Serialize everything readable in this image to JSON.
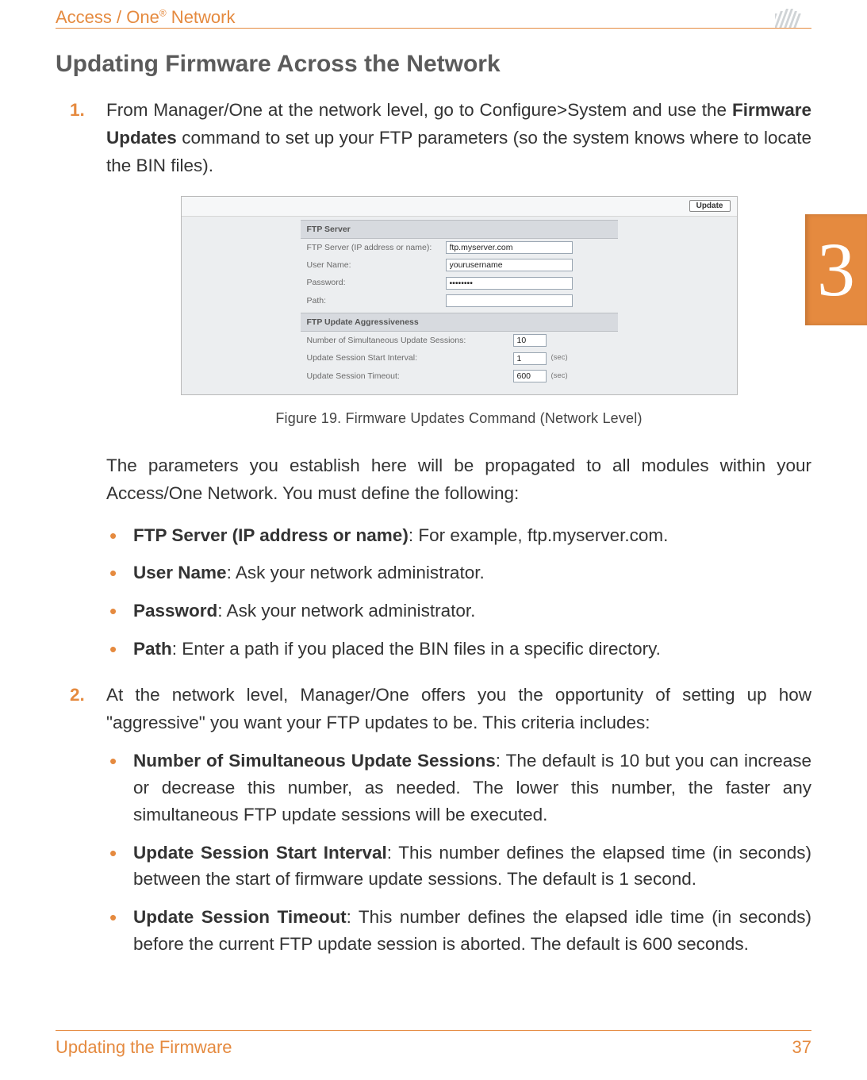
{
  "header": {
    "title_prefix": "Access / One",
    "title_suffix": " Network"
  },
  "chapter": {
    "number": "3"
  },
  "section": {
    "heading": "Updating Firmware Across the Network"
  },
  "steps": [
    {
      "num": "1.",
      "paras": [
        {
          "runs": [
            {
              "t": "From Manager/One at the network level, go to Configure>System and use the "
            },
            {
              "t": "Firmware Updates",
              "b": true
            },
            {
              "t": " command to set up your FTP parameters (so the system knows where to locate the BIN files)."
            }
          ]
        }
      ],
      "figure": {
        "update_btn": "Update",
        "group1": "FTP Server",
        "rows1": [
          {
            "label": "FTP Server (IP address or name):",
            "value": "ftp.myserver.com",
            "type": "text",
            "cls": "w-long"
          },
          {
            "label": "User Name:",
            "value": "yourusername",
            "type": "text",
            "cls": "w-long"
          },
          {
            "label": "Password:",
            "value": "••••••••",
            "type": "password",
            "cls": "w-long"
          },
          {
            "label": "Path:",
            "value": "",
            "type": "text",
            "cls": "w-long-empty"
          }
        ],
        "group2": "FTP Update Aggressiveness",
        "rows2": [
          {
            "label": "Number of Simultaneous Update Sessions:",
            "value": "10",
            "unit": ""
          },
          {
            "label": "Update Session Start Interval:",
            "value": "1",
            "unit": "(sec)"
          },
          {
            "label": "Update Session Timeout:",
            "value": "600",
            "unit": "(sec)"
          }
        ],
        "caption": "Figure 19. Firmware Updates Command (Network Level)"
      },
      "after_figure": "The parameters you establish here will be propagated to all modules within your Access/One Network. You must define the following:",
      "bullets": [
        {
          "runs": [
            {
              "t": "FTP Server (IP address or name)",
              "b": true
            },
            {
              "t": ": For example, ftp.myserver.com."
            }
          ]
        },
        {
          "runs": [
            {
              "t": "User Name",
              "b": true
            },
            {
              "t": ": Ask your network administrator."
            }
          ]
        },
        {
          "runs": [
            {
              "t": "Password",
              "b": true
            },
            {
              "t": ": Ask your network administrator."
            }
          ]
        },
        {
          "runs": [
            {
              "t": "Path",
              "b": true
            },
            {
              "t": ": Enter a path if you placed the BIN files in a specific directory."
            }
          ]
        }
      ]
    },
    {
      "num": "2.",
      "paras": [
        {
          "runs": [
            {
              "t": "At the network level, Manager/One offers you the opportunity of setting up how \"aggressive\" you want your FTP updates to be. This criteria includes:"
            }
          ]
        }
      ],
      "bullets": [
        {
          "runs": [
            {
              "t": "Number of Simultaneous Update Sessions",
              "b": true
            },
            {
              "t": ": The default is 10 but you can increase or decrease this number, as needed. The lower this number, the faster any simultaneous FTP update sessions will be executed."
            }
          ]
        },
        {
          "runs": [
            {
              "t": "Update Session Start Interval",
              "b": true
            },
            {
              "t": ": This number defines the elapsed time (in seconds) between the start of firmware update sessions. The default is 1 second."
            }
          ]
        },
        {
          "runs": [
            {
              "t": "Update Session Timeout",
              "b": true
            },
            {
              "t": ": This number defines the elapsed idle time (in seconds) before the current FTP update session is aborted. The default is 600 seconds."
            }
          ]
        }
      ]
    }
  ],
  "footer": {
    "left": "Updating the Firmware",
    "right": "37"
  }
}
